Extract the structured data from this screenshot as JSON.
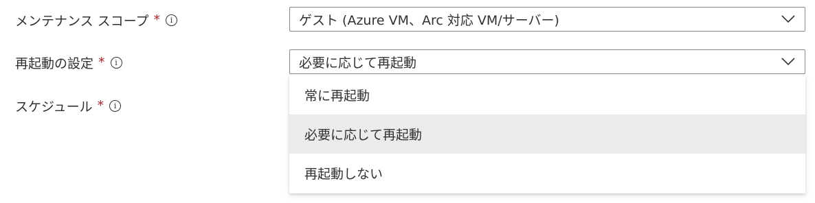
{
  "form": {
    "maintenance_scope": {
      "label": "メンテナンス スコープ",
      "required_mark": "*",
      "info_glyph": "i",
      "value": "ゲスト (Azure VM、Arc 対応 VM/サーバー)",
      "icon": "chevron-down-icon"
    },
    "reboot_setting": {
      "label": "再起動の設定",
      "required_mark": "*",
      "info_glyph": "i",
      "value": "必要に応じて再起動",
      "icon": "chevron-down-icon",
      "options": [
        {
          "label": "常に再起動",
          "selected": false
        },
        {
          "label": "必要に応じて再起動",
          "selected": true
        },
        {
          "label": "再起動しない",
          "selected": false
        }
      ]
    },
    "schedule": {
      "label": "スケジュール",
      "required_mark": "*",
      "info_glyph": "i"
    }
  },
  "colors": {
    "required": "#a4262c",
    "selected_option_bg": "#edebe9",
    "border": "#8a8886",
    "text": "#323130"
  }
}
